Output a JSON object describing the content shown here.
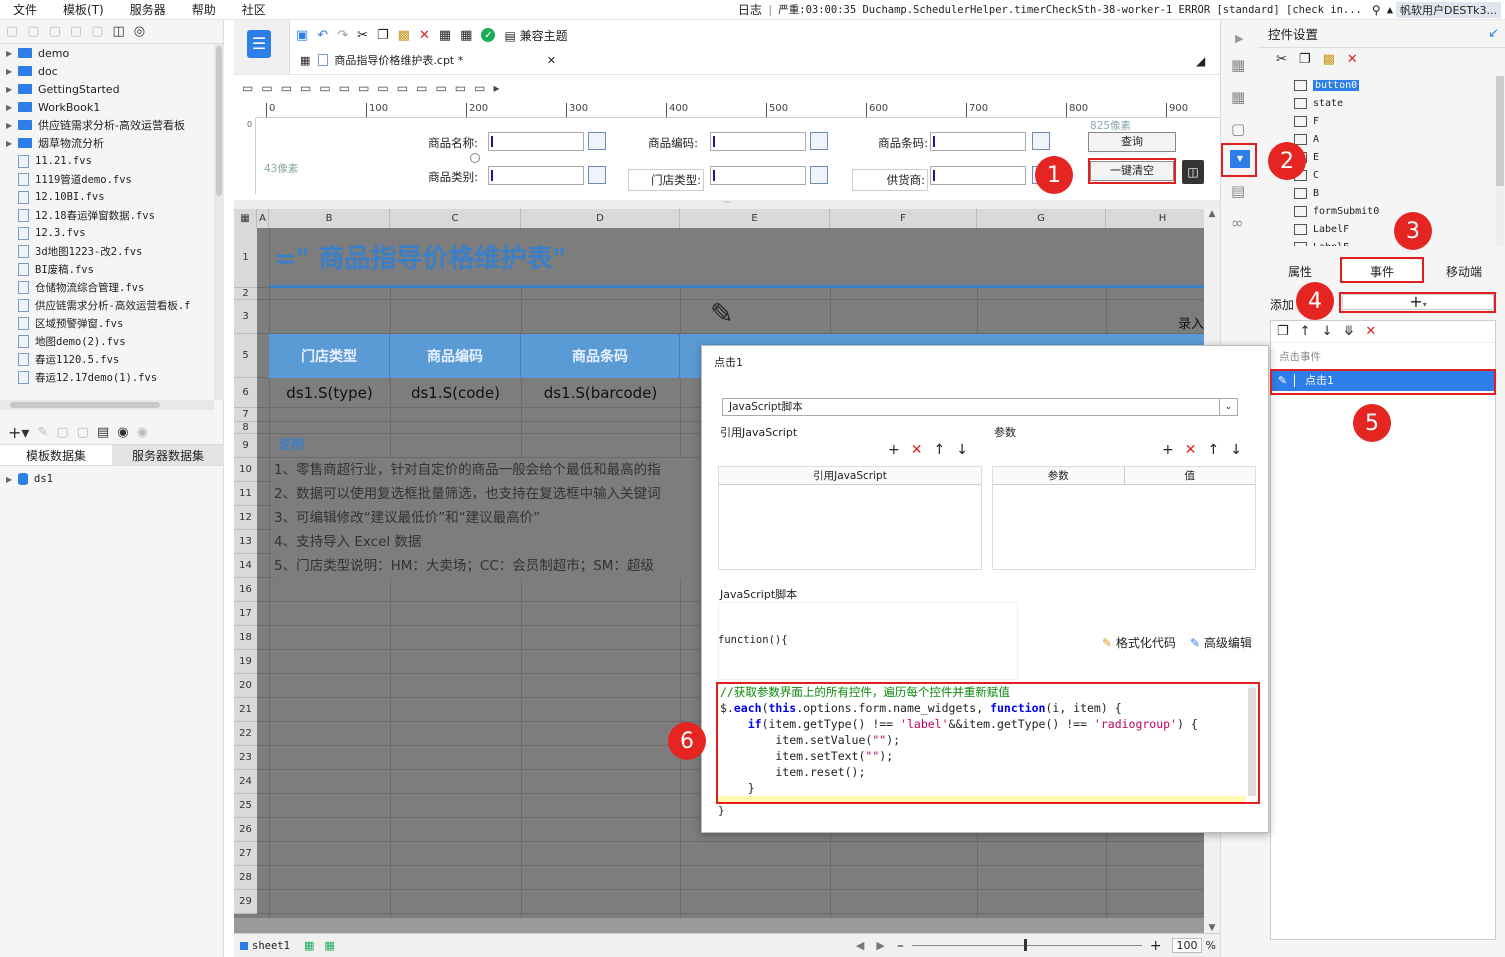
{
  "menu": [
    "文件",
    "模板(T)",
    "服务器",
    "帮助",
    "社区"
  ],
  "status": {
    "log_label": "日志",
    "error_text": "严重:03:00:35 Duchamp.SchedulerHelper.timerCheckSth-38-worker-1 ERROR [standard] [check in...",
    "user": "帆软用户DESTk3..."
  },
  "tree": [
    {
      "n": "demo",
      "t": "folder"
    },
    {
      "n": "doc",
      "t": "folder"
    },
    {
      "n": "GettingStarted",
      "t": "folder"
    },
    {
      "n": "WorkBook1",
      "t": "folder"
    },
    {
      "n": "供应链需求分析-高效运营看板",
      "t": "folder"
    },
    {
      "n": "烟草物流分析",
      "t": "folder"
    },
    {
      "n": "11.21.fvs",
      "t": "file"
    },
    {
      "n": "1119管道demo.fvs",
      "t": "file"
    },
    {
      "n": "12.10BI.fvs",
      "t": "file"
    },
    {
      "n": "12.18春运弹窗数据.fvs",
      "t": "file"
    },
    {
      "n": "12.3.fvs",
      "t": "file"
    },
    {
      "n": "3d地图1223-改2.fvs",
      "t": "file"
    },
    {
      "n": "BI废稿.fvs",
      "t": "file"
    },
    {
      "n": "仓储物流综合管理.fvs",
      "t": "file"
    },
    {
      "n": "供应链需求分析-高效运营看板.f",
      "t": "file"
    },
    {
      "n": "区域预警弹窗.fvs",
      "t": "file"
    },
    {
      "n": "地图demo(2).fvs",
      "t": "file"
    },
    {
      "n": "春运1120.5.fvs",
      "t": "file"
    },
    {
      "n": "春运12.17demo(1).fvs",
      "t": "file"
    }
  ],
  "ds_tabs": [
    "模板数据集",
    "服务器数据集"
  ],
  "ds_items": [
    "ds1"
  ],
  "toolbar": {
    "theme_label": "兼容主题"
  },
  "doc_tab": "商品指导价格维护表.cpt *",
  "ruler": [
    "0",
    "100",
    "200",
    "300",
    "400",
    "500",
    "600",
    "700",
    "800",
    "900"
  ],
  "form": {
    "px_top": "825像素",
    "px_left": "43像素",
    "labels": [
      "商品名称:",
      "商品编码:",
      "商品条码:",
      "商品类别:",
      "门店类型:",
      "供货商:"
    ],
    "query_btn": "查询",
    "clear_btn": "一键清空"
  },
  "sheet": {
    "cols": [
      "A",
      "B",
      "C",
      "D",
      "E",
      "F",
      "G",
      "H"
    ],
    "rows": [
      "1",
      "2",
      "3",
      "5",
      "6",
      "7",
      "8",
      "9",
      "10",
      "11",
      "12",
      "13",
      "14",
      "16",
      "17",
      "18",
      "19",
      "20",
      "21",
      "22",
      "23",
      "24",
      "25",
      "26",
      "27",
      "28",
      "29"
    ],
    "title": "=\" 商品指导价格维护表\"",
    "entry": "录入",
    "headers": [
      "门店类型",
      "商品编码",
      "商品条码"
    ],
    "exprs": [
      "ds1.S(type)",
      "ds1.S(code)",
      "ds1.S(barcode)"
    ],
    "notes_title": "说明",
    "notes": [
      "1、零售商超行业，针对自定价的商品一般会给个最低和最高的指",
      "2、数据可以使用复选框批量筛选，也支持在复选框中输入关键词",
      "3、可编辑修改“建议最低价”和“建议最高价”",
      "4、支持导入 Excel 数据",
      "5、门店类型说明：HM：大卖场；CC：会员制超市；SM：超级"
    ],
    "sheet_tab": "sheet1",
    "zoom": "100"
  },
  "dialog": {
    "title": "点击1",
    "type": "JavaScript脚本",
    "ref_js": "引用JavaScript",
    "params": "参数",
    "param_col": "参数",
    "value_col": "值",
    "js_label": "JavaScript脚本",
    "fn_open": "function(){",
    "format": "格式化代码",
    "advanced": "高级编辑",
    "fn_close": "}",
    "code": [
      "//获取参数界面上的所有控件，遍历每个控件并重新赋值",
      "$.each(this.options.form.name_widgets, function(i, item) {",
      "    if(item.getType() !== 'label'&&item.getType() !== 'radiogroup') {",
      "        item.setValue(\"\");",
      "        item.setText(\"\");",
      "        item.reset();",
      "    }",
      "});"
    ]
  },
  "right": {
    "title": "控件设置",
    "widgets": [
      "button0",
      "state",
      "F",
      "A",
      "E",
      "C",
      "B",
      "formSubmit0",
      "LabelF",
      "LabelE"
    ],
    "tabs": [
      "属性",
      "事件",
      "移动端"
    ],
    "add_label": "添加",
    "event_group": "点击事件",
    "event_item": "点击1"
  },
  "badges": [
    "1",
    "2",
    "3",
    "4",
    "5",
    "6"
  ],
  "colors": {
    "accent": "#2d7ee8",
    "badge": "#e52521",
    "title_blue": "#3a7fc8",
    "header_blue": "#5b9bd5"
  }
}
